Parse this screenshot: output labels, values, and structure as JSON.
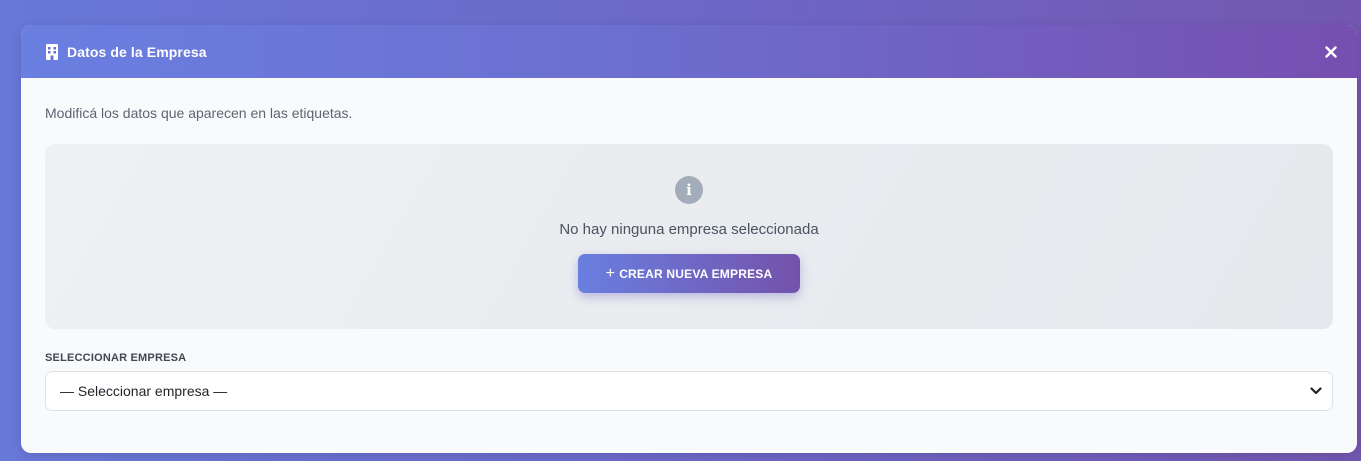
{
  "modal": {
    "title": "Datos de la Empresa",
    "header_icon": "building-icon",
    "close_icon": "close-icon"
  },
  "body": {
    "description": "Modificá los datos que aparecen en las etiquetas.",
    "empty_state": {
      "icon": "info-icon",
      "icon_glyph": "i",
      "message": "No hay ninguna empresa seleccionada",
      "create_button": {
        "plus": "+",
        "label": "CREAR NUEVA EMPRESA"
      }
    },
    "select": {
      "label": "SELECCIONAR EMPRESA",
      "value": "— Seleccionar empresa —",
      "icon": "chevron-down-icon"
    }
  },
  "colors": {
    "accent_start": "#6a7fe0",
    "accent_end": "#764fb0",
    "panel_bg": "#f9fafb"
  }
}
